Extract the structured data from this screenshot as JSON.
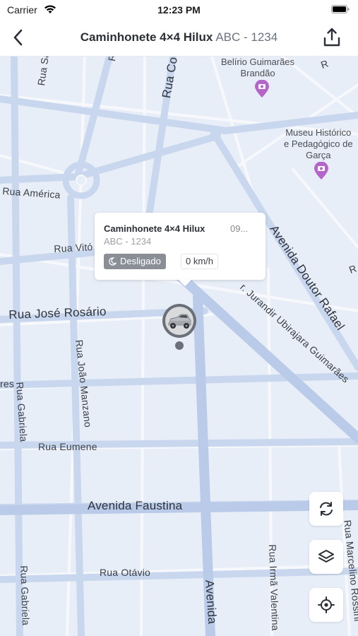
{
  "status_bar": {
    "carrier": "Carrier",
    "time": "12:23 PM"
  },
  "header": {
    "title": "Caminhonete 4×4 Hilux",
    "plate": "ABC - 1234"
  },
  "map": {
    "streets": [
      "Rua Sarg",
      "Rua Co",
      "Rua América",
      "Rua Vitó",
      "Rua José Rosário",
      "Rua João Manzano",
      "res",
      "Rua Gabriela",
      "Rua Eumene",
      "Avenida Faustina",
      "Rua Otávio",
      "Rua Gabriela",
      "Avenida",
      "Rua Irmã Valentina",
      "Rua Marcelino Rossini",
      "Avenida Doutor Rafael",
      "r. Jurandir Ubirajara Guimarães",
      "R",
      "R",
      "R"
    ],
    "pois": [
      {
        "name": "Belírio Guimarães\nBrandão",
        "icon": "camera-pin-icon"
      },
      {
        "name": "Museu Histórico\ne Pedagógico de\nGarça",
        "icon": "camera-pin-icon"
      }
    ]
  },
  "callout": {
    "vehicle_name": "Caminhonete 4×4 Hilux",
    "time": "09...",
    "plate": "ABC - 1234",
    "status": "Desligado",
    "speed": "0 km/h"
  },
  "controls": {
    "refresh": "refresh-icon",
    "layers": "layers-icon",
    "locate": "locate-icon"
  },
  "colors": {
    "map_bg": "#e8eef7",
    "road": "#c5d4ec",
    "poi": "#b564c9",
    "marker": "#6b7078"
  }
}
